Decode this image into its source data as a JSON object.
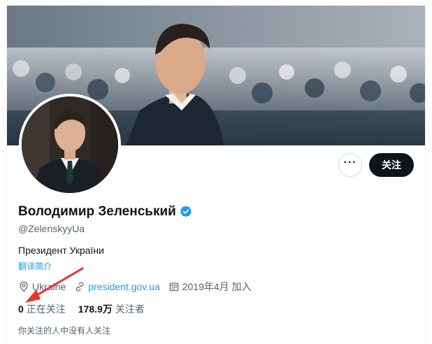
{
  "profile": {
    "display_name": "Володимир Зеленський",
    "handle": "@ZelenskyyUa",
    "bio": "Президент України",
    "translate_label": "翻译简介",
    "location": "Ukraine",
    "website": "president.gov.ua",
    "joined": "2019年4月 加入",
    "following_count": "0",
    "following_label": "正在关注",
    "followers_count": "178.9万",
    "followers_label": "关注者",
    "followers_note": "你关注的人中没有人关注"
  },
  "actions": {
    "more_label": "···",
    "follow_label": "关注"
  },
  "icons": {
    "verified": "verified-badge-icon",
    "location": "location-pin-icon",
    "link": "link-icon",
    "calendar": "calendar-icon",
    "more": "more-dots-icon"
  },
  "colors": {
    "accent": "#1d9bf0",
    "text_primary": "#0f1419",
    "text_secondary": "#536471",
    "follow_button_bg": "#0f1419",
    "annotation_arrow": "#e0362b"
  }
}
